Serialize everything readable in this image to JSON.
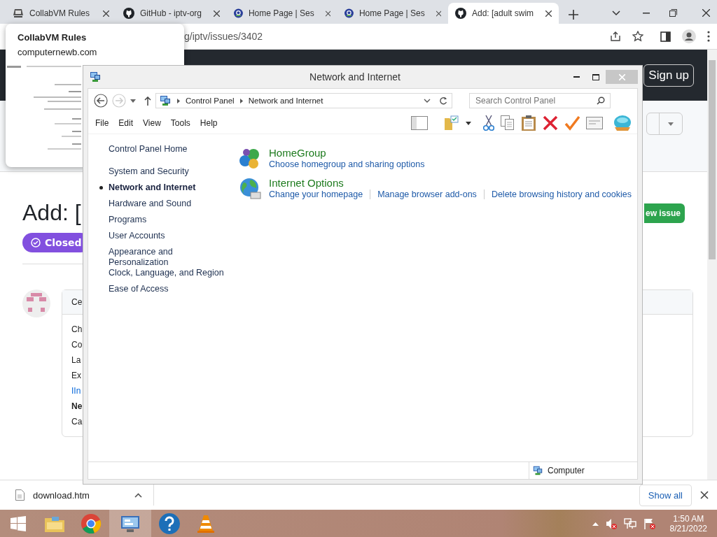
{
  "browser": {
    "tabs": [
      {
        "title": "CollabVM Rules",
        "selected": false
      },
      {
        "title": "GitHub - iptv-org",
        "selected": false
      },
      {
        "title": "Home Page | Ses",
        "selected": false
      },
      {
        "title": "Home Page | Ses",
        "selected": false
      },
      {
        "title": "Add: [adult swim",
        "selected": true
      }
    ],
    "url": "g/iptv/issues/3402",
    "tooltip": {
      "title": "CollabVM Rules",
      "domain": "computernewb.com"
    },
    "page": {
      "sign_up": "Sign up",
      "heading": "Add: [",
      "status": "Closed",
      "new_issue": "ew issue",
      "comment_header": "Ce",
      "comment_lines": [
        {
          "text": "Ch",
          "kind": "text"
        },
        {
          "text": "Co",
          "kind": "text"
        },
        {
          "text": "La",
          "kind": "text"
        },
        {
          "text": "Ex",
          "kind": "text"
        },
        {
          "text": "IIn",
          "kind": "link"
        },
        {
          "text": "Ne",
          "kind": "bold"
        },
        {
          "text": "Ca",
          "kind": "text"
        }
      ]
    },
    "downloads": {
      "file": "download.htm",
      "show_all": "Show all"
    }
  },
  "explorer": {
    "title": "Network and Internet",
    "breadcrumb": [
      "Control Panel",
      "Network and Internet"
    ],
    "search": {
      "placeholder": "Search Control Panel"
    },
    "menu": [
      "File",
      "Edit",
      "View",
      "Tools",
      "Help"
    ],
    "sidebar": {
      "home": "Control Panel Home",
      "items": [
        {
          "label": "System and Security",
          "selected": false
        },
        {
          "label": "Network and Internet",
          "selected": true
        },
        {
          "label": "Hardware and Sound",
          "selected": false
        },
        {
          "label": "Programs",
          "selected": false
        },
        {
          "label": "User Accounts",
          "selected": false
        },
        {
          "label": "Appearance and Personalization",
          "selected": false
        },
        {
          "label": "Clock, Language, and Region",
          "selected": false
        },
        {
          "label": "Ease of Access",
          "selected": false
        }
      ]
    },
    "categories": [
      {
        "title": "HomeGroup",
        "links": [
          "Choose homegroup and sharing options"
        ]
      },
      {
        "title": "Internet Options",
        "links": [
          "Change your homepage",
          "Manage browser add-ons",
          "Delete browsing history and cookies"
        ]
      }
    ],
    "status": "Computer"
  },
  "taskbar": {
    "time": "1:50 AM",
    "date": "8/21/2022"
  }
}
